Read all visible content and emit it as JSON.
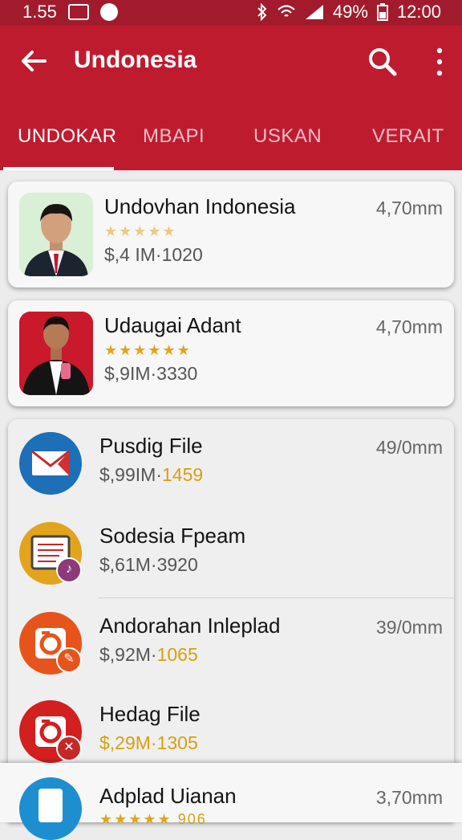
{
  "status_bar": {
    "time_left": "1.55",
    "battery": "49%",
    "time_right": "12:00"
  },
  "app_bar": {
    "title": "Undonesia"
  },
  "tabs": [
    {
      "label": "UNDOKAR",
      "active": true
    },
    {
      "label": "MBAPI",
      "active": false
    },
    {
      "label": "USKAN",
      "active": false
    },
    {
      "label": "VERAIT",
      "active": false
    }
  ],
  "featured": [
    {
      "title": "Undovhan Indonesia",
      "stars": "★★★★★",
      "meta": "$,4 IM·1020",
      "size": "4,70mm"
    },
    {
      "title": "Udaugai Adant",
      "stars": "★★★★★★",
      "meta": "$,9IM·3330",
      "size": "4,70mm"
    }
  ],
  "list": [
    {
      "title": "Pusdig File",
      "meta_prefix": "$,99IM·",
      "meta_num": "1459",
      "size": "49/0mm",
      "icon": "mail-icon"
    },
    {
      "title": "Sodesia Fpeam",
      "meta_prefix": "$,61M·",
      "meta_num": "3920",
      "size": "",
      "icon": "document-icon"
    },
    {
      "title": "Andorahan Inleplad",
      "meta_prefix": "$,92M·",
      "meta_num": "1065",
      "size": "39/0mm",
      "icon": "camera-icon"
    },
    {
      "title": "Hedag File",
      "meta_prefix": "$,29M·",
      "meta_num": "1305",
      "size": "",
      "icon": "camera-icon"
    }
  ],
  "bottom_item": {
    "title": "Adplad Uianan",
    "size": "3,70mm",
    "stars": "★★★★★",
    "meta_num": "906"
  },
  "colors": {
    "primary": "#bf1b2f",
    "statusbar": "#a21b2c",
    "accent_number": "#d7a010",
    "star": "#e2a41c"
  }
}
